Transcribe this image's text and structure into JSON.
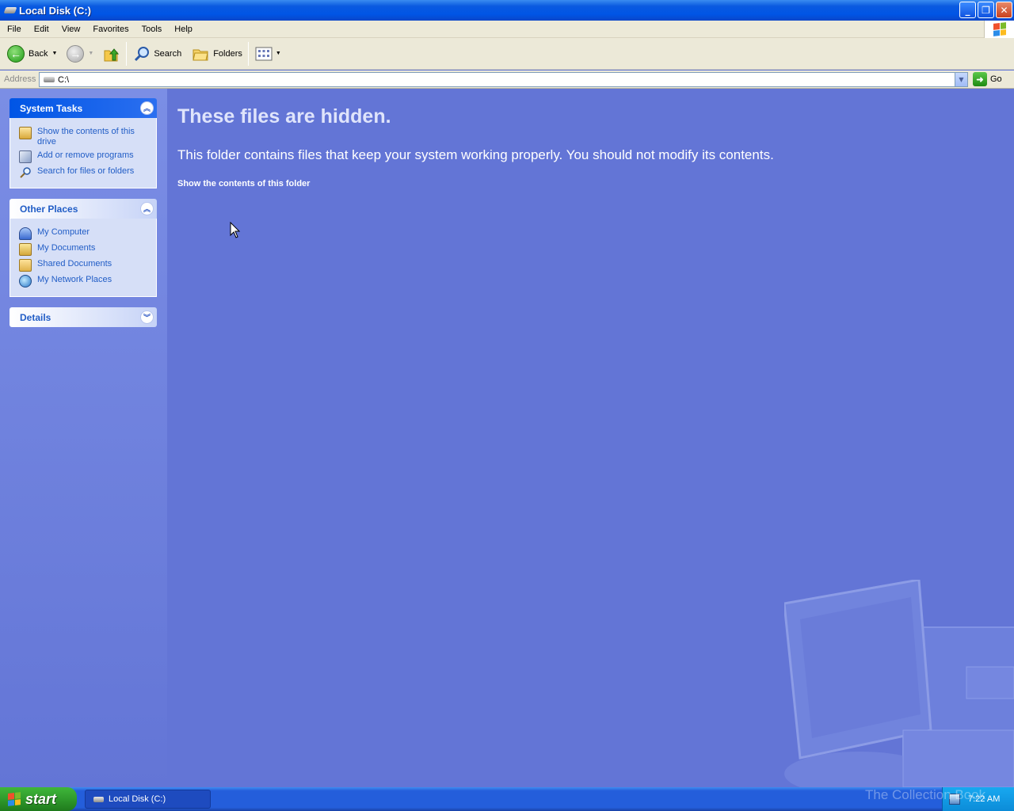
{
  "window": {
    "title": "Local Disk (C:)"
  },
  "menubar": {
    "items": [
      "File",
      "Edit",
      "View",
      "Favorites",
      "Tools",
      "Help"
    ]
  },
  "toolbar": {
    "back_label": "Back",
    "search_label": "Search",
    "folders_label": "Folders"
  },
  "address": {
    "label": "Address",
    "value": "C:\\",
    "go_label": "Go"
  },
  "system_tasks": {
    "title": "System Tasks",
    "items": [
      {
        "label": "Show the contents of this drive",
        "icon": "show-contents-icon"
      },
      {
        "label": "Add or remove programs",
        "icon": "add-remove-programs-icon"
      },
      {
        "label": "Search for files or folders",
        "icon": "search-icon"
      }
    ]
  },
  "other_places": {
    "title": "Other Places",
    "items": [
      {
        "label": "My Computer",
        "icon": "my-computer-icon"
      },
      {
        "label": "My Documents",
        "icon": "my-documents-icon"
      },
      {
        "label": "Shared Documents",
        "icon": "shared-documents-icon"
      },
      {
        "label": "My Network Places",
        "icon": "my-network-places-icon"
      }
    ]
  },
  "details": {
    "title": "Details"
  },
  "main": {
    "heading": "These files are hidden.",
    "message": "This folder contains files that keep your system working properly. You should not modify its contents.",
    "link": "Show the contents of this folder"
  },
  "taskbar": {
    "start_label": "start",
    "task_label": "Local Disk (C:)",
    "clock": "7:22 AM"
  },
  "watermark": {
    "text": "The Collection Book"
  },
  "colors": {
    "titlebar": "#0055e5",
    "content_bg": "#6375d6",
    "link": "#215dc6",
    "start": "#2f9a2c"
  }
}
